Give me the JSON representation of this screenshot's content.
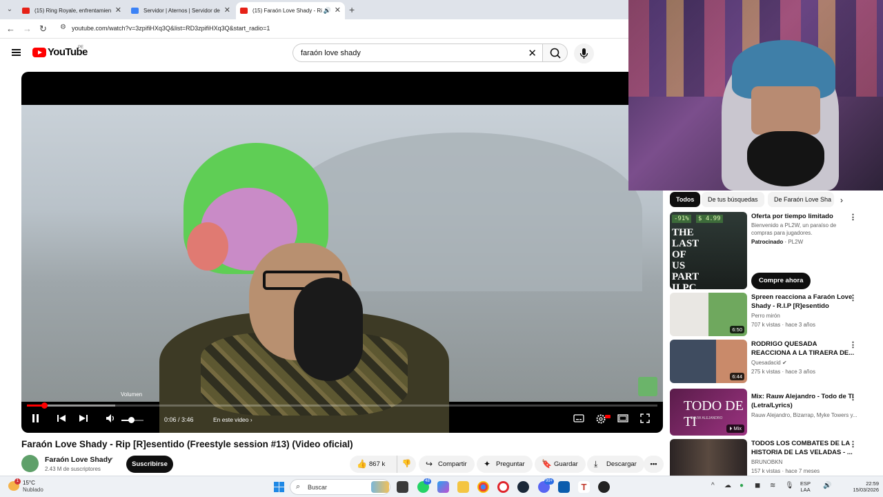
{
  "browser": {
    "tabs": [
      {
        "title": "(15) Ring Royale, enfrentamien",
        "favicon_color": "#e62117"
      },
      {
        "title": "Servidor | Aternos | Servidor de",
        "favicon_color": "#3b82f6"
      },
      {
        "title": "(15) Faraón Love Shady - Ri",
        "favicon_color": "#e62117"
      }
    ],
    "url": "youtube.com/watch?v=3zpifiHXq3Q&list=RD3zpifiHXq3Q&start_radio=1"
  },
  "yt": {
    "logo_text": "YouTube",
    "country": "PE",
    "search_query": "faraón love shady"
  },
  "player": {
    "volume_tooltip": "Volumen",
    "time": "0:06 / 3:46",
    "chapter_label": "En este video",
    "played_fraction": 0.027,
    "buffered_fraction": 0.14,
    "volume_fraction": 0.45,
    "accent": "#ff0000"
  },
  "video": {
    "title": "Faraón Love Shady - Rip [R]esentido (Freestyle session #13) (Video oficial)",
    "channel": "Faraón Love Shady",
    "subscribers": "2.43 M de suscriptores",
    "subscribe_label": "Suscribirse",
    "likes": "867 k",
    "share": "Compartir",
    "ask": "Preguntar",
    "save": "Guardar",
    "download": "Descargar"
  },
  "sidebar": {
    "chips": [
      "Todos",
      "De tus búsquedas",
      "De Faraón Love Sha"
    ],
    "ad": {
      "discount": "-91%",
      "price": "$ 4.99",
      "art_text": "THE LAST OF US PART II PC",
      "title": "Oferta por tiempo limitado",
      "desc": "Bienvenido a PL2W, un paraíso de compras para jugadores.",
      "sponsored": "Patrocinado",
      "advertiser": "PL2W",
      "cta": "Compre ahora"
    },
    "recs": [
      {
        "title": "Spreen reacciona a Faraón Love Shady - R.I.P [R]esentido",
        "channel": "Perro mirón",
        "meta": "707 k vistas · hace 3 años",
        "duration": "6:50",
        "thumb_color": "#6fa85e"
      },
      {
        "title": "RODRIGO QUESADA REACCIONA A LA TIRAERA DE...",
        "channel": "Quesadacid",
        "meta": "275 k vistas · hace 3 años",
        "duration": "6:44",
        "thumb_color": "#4a5d7a"
      },
      {
        "title": "Mix: Rauw Alejandro - Todo de Ti (Letra/Lyrics)",
        "channel": "Rauw Alejandro, Bizarrap, Myke Towers y...",
        "meta": "",
        "duration": "Mix",
        "thumb_color": "#7a2a6a",
        "thumb_text": "TODO DE TI",
        "thumb_sub": "RAUW ALEJANDRO"
      },
      {
        "title": "TODOS LOS COMBATES DE LA HISTORIA DE LAS VELADAS - ...",
        "channel": "BRUNOBKN",
        "meta": "157 k vistas · hace 7 meses",
        "duration": "",
        "thumb_color": "#3a3030"
      }
    ]
  },
  "taskbar": {
    "temp": "15°C",
    "condition": "Nublado",
    "weather_badge": "1",
    "search_placeholder": "Buscar",
    "badges": [
      "48",
      "99+"
    ],
    "lang_top": "ESP",
    "lang_bottom": "LAA",
    "time": "22:59",
    "date": "15/03/2026"
  }
}
